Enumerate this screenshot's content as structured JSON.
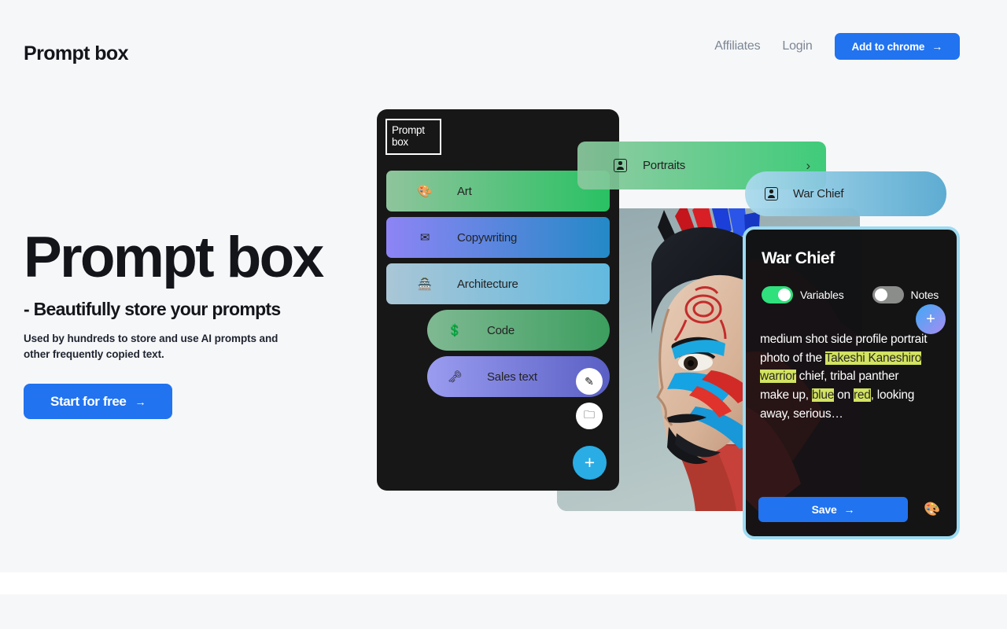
{
  "header": {
    "brand": "Prompt box",
    "nav": [
      {
        "label": "Affiliates",
        "name": "affiliates"
      },
      {
        "label": "Login",
        "name": "login"
      }
    ],
    "cta": {
      "label": "Add to chrome",
      "icon": "arrow-right-icon",
      "arrow": "→",
      "color": "#2173ef"
    }
  },
  "hero": {
    "title": "Prompt box",
    "subtitle": "- Beautifully store your prompts",
    "description": "Used by hundreds to store and use AI prompts and other frequently copied text.",
    "cta": {
      "label": "Start for free",
      "arrow": "→",
      "color": "#2173ef"
    }
  },
  "app_mock": {
    "panel_logo": "Prompt box",
    "categories": [
      {
        "label": "Art",
        "icon": "palette-icon",
        "glyph": "🎨",
        "level": 0,
        "gradient_class": "g-art"
      },
      {
        "label": "Copywriting",
        "icon": "envelope-icon",
        "glyph": "✉",
        "level": 0,
        "gradient_class": "g-copy"
      },
      {
        "label": "Architecture",
        "icon": "building-icon",
        "glyph": "🏯",
        "level": 0,
        "gradient_class": "g-arch"
      },
      {
        "label": "Code",
        "icon": "dollar-coin-icon",
        "glyph": "💲",
        "level": 1,
        "gradient_class": "g-code"
      },
      {
        "label": "Sales text",
        "icon": "key-icon",
        "glyph": "🗝",
        "level": 1,
        "gradient_class": "g-sales"
      }
    ],
    "panel_actions": [
      {
        "name": "edit-button",
        "glyph": "✎"
      },
      {
        "name": "new-folder-button",
        "glyph": "🗀"
      },
      {
        "name": "add-button",
        "glyph": "+"
      }
    ],
    "breadcrumb_pills": [
      {
        "label": "Portraits",
        "icon": "portrait-icon",
        "chevron": "›"
      },
      {
        "label": "War Chief",
        "icon": "portrait-icon"
      }
    ]
  },
  "editor": {
    "title": "War Chief",
    "toggles": [
      {
        "label": "Variables",
        "state": "on",
        "color": "#2fe07c"
      },
      {
        "label": "Notes",
        "state": "off",
        "color": "#8b8d8b"
      }
    ],
    "add_variable": {
      "name": "add-variable-button",
      "glyph": "+"
    },
    "prompt": {
      "segments": [
        {
          "text": "medium shot side profile portrait photo of the ",
          "highlight": false
        },
        {
          "text": "Takeshi Kaneshiro",
          "highlight": true
        },
        {
          "text": " ",
          "highlight": false
        },
        {
          "text": "warrior",
          "highlight": true
        },
        {
          "text": " chief, tribal panther make up, ",
          "highlight": false
        },
        {
          "text": "blue",
          "highlight": true
        },
        {
          "text": " on ",
          "highlight": false
        },
        {
          "text": "red",
          "highlight": true
        },
        {
          "text": ", looking away, serious…",
          "highlight": false
        }
      ],
      "highlight_color": "#d3e362"
    },
    "save": {
      "label": "Save",
      "arrow": "→",
      "color": "#2173ef"
    },
    "palette": {
      "name": "palette-button",
      "glyph": "🎨"
    }
  }
}
